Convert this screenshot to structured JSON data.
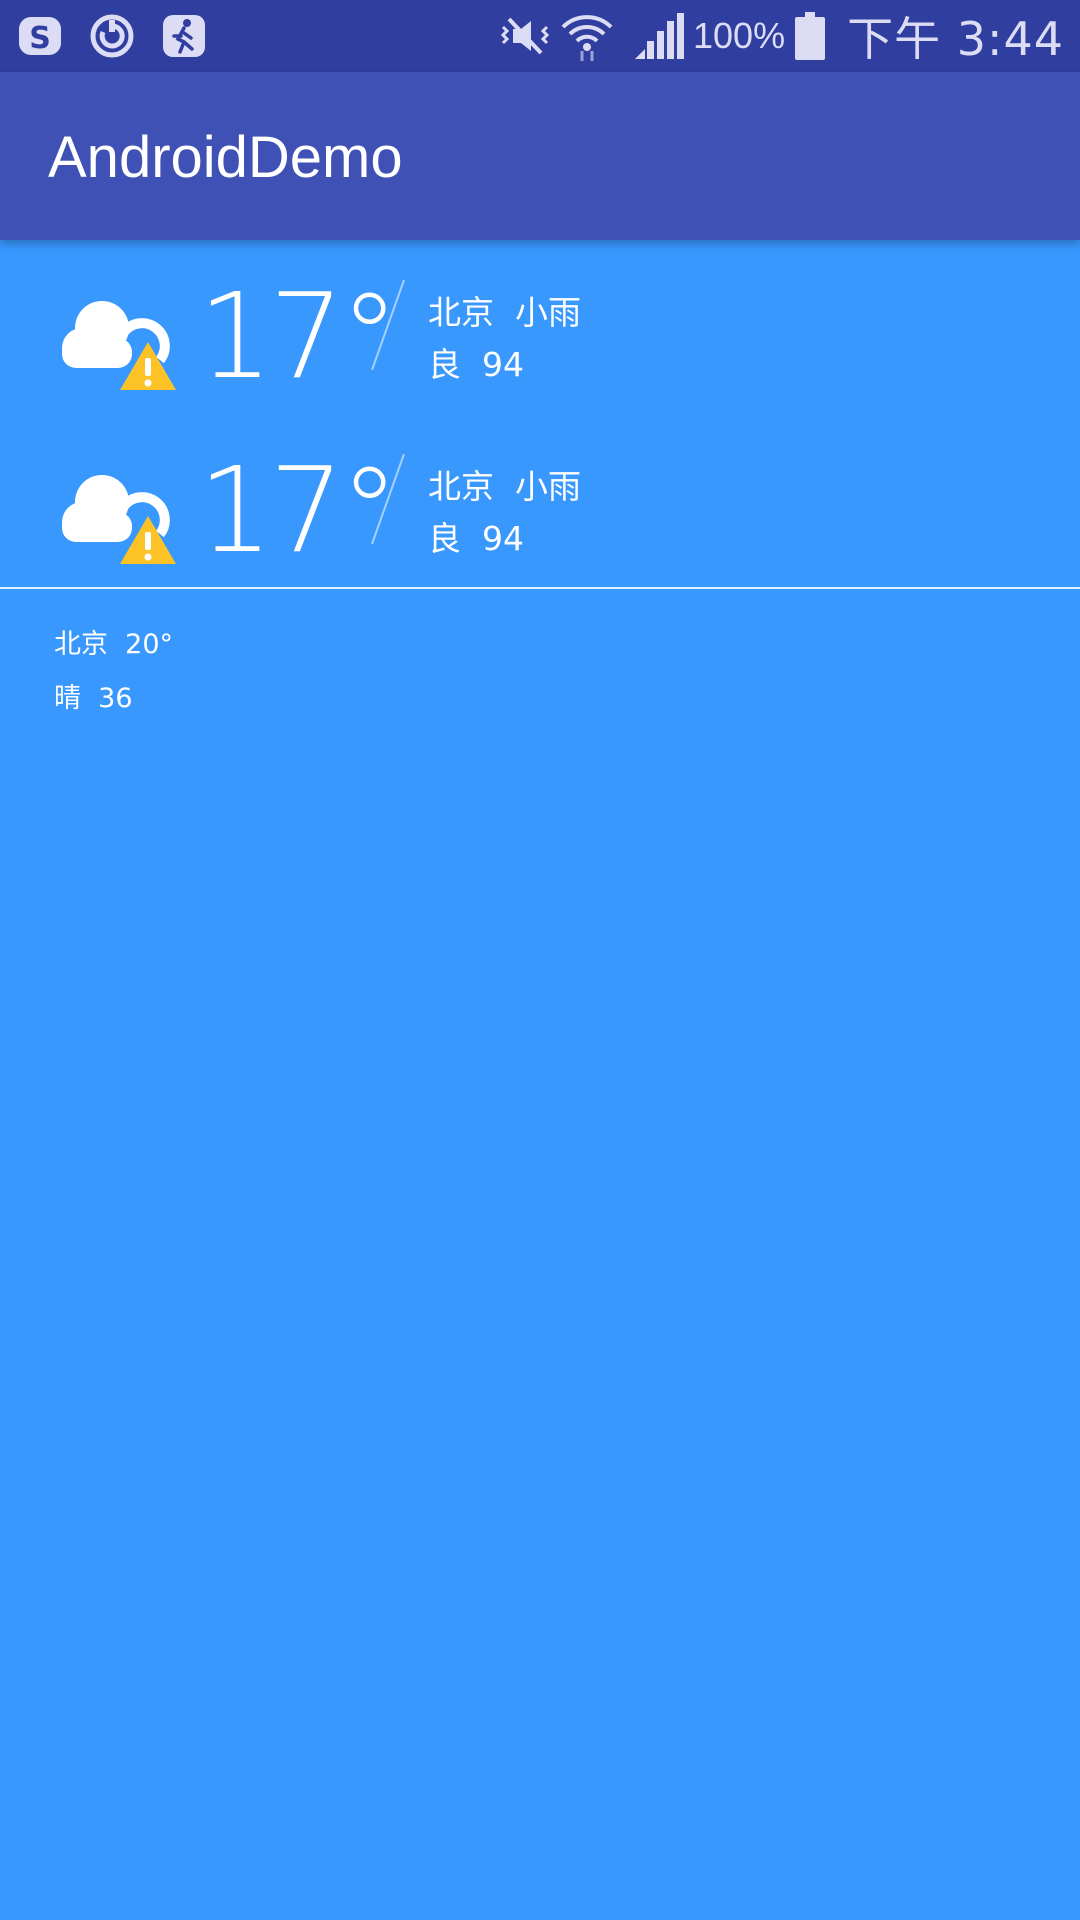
{
  "status_bar": {
    "left_icons": [
      "s-app-icon",
      "sync-icon",
      "runner-app-icon"
    ],
    "right_icons": [
      "vibrate-icon",
      "wifi-icon",
      "signal-icon"
    ],
    "battery_percent": "100%",
    "time": "下午 3:44",
    "color": "#303f9f"
  },
  "app_bar": {
    "title": "AndroidDemo",
    "color": "#3f51b5"
  },
  "background_color": "#3898fe",
  "weather_items": [
    {
      "icon": "cloud-warning-icon",
      "temperature": "17°",
      "city_weather": "北京  小雨",
      "aqi": "良  94"
    },
    {
      "icon": "cloud-warning-icon",
      "temperature": "17°",
      "city_weather": "北京  小雨",
      "aqi": "良  94"
    }
  ],
  "summary": {
    "line1": "北京  20°",
    "line2": "晴  36"
  }
}
